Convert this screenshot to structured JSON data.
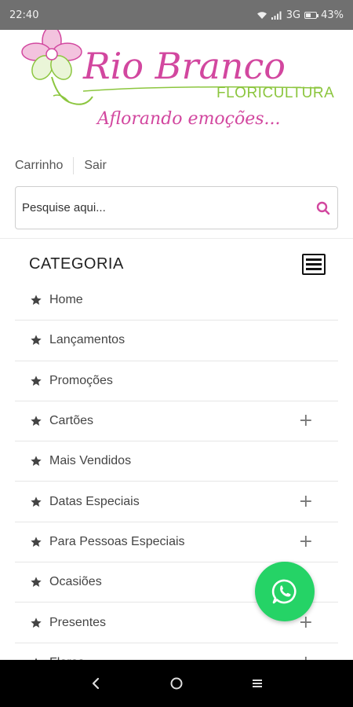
{
  "status_bar": {
    "time": "22:40",
    "network": "3G",
    "battery": "43%",
    "battery_level": 0.43
  },
  "brand": {
    "name": "Rio Branco",
    "subtitle": "FLORICULTURA",
    "tagline": "Aflorando emoções...",
    "colors": {
      "pink": "#d2479f",
      "green": "#8cc63f"
    }
  },
  "header_links": {
    "cart": "Carrinho",
    "logout": "Sair"
  },
  "search": {
    "placeholder": "Pesquise aqui...",
    "value": ""
  },
  "category": {
    "title": "CATEGORIA",
    "items": [
      {
        "label": "Home",
        "expandable": false
      },
      {
        "label": "Lançamentos",
        "expandable": false
      },
      {
        "label": "Promoções",
        "expandable": false
      },
      {
        "label": "Cartões",
        "expandable": true
      },
      {
        "label": "Mais Vendidos",
        "expandable": false
      },
      {
        "label": "Datas Especiais",
        "expandable": true
      },
      {
        "label": "Para Pessoas Especiais",
        "expandable": true
      },
      {
        "label": "Ocasiões",
        "expandable": false
      },
      {
        "label": "Presentes",
        "expandable": true
      },
      {
        "label": "Flores",
        "expandable": true
      }
    ]
  },
  "fab": {
    "icon": "whatsapp-icon",
    "color": "#25d366"
  },
  "nav_bar": {
    "icons": [
      "back-icon",
      "home-icon",
      "recents-icon"
    ]
  }
}
